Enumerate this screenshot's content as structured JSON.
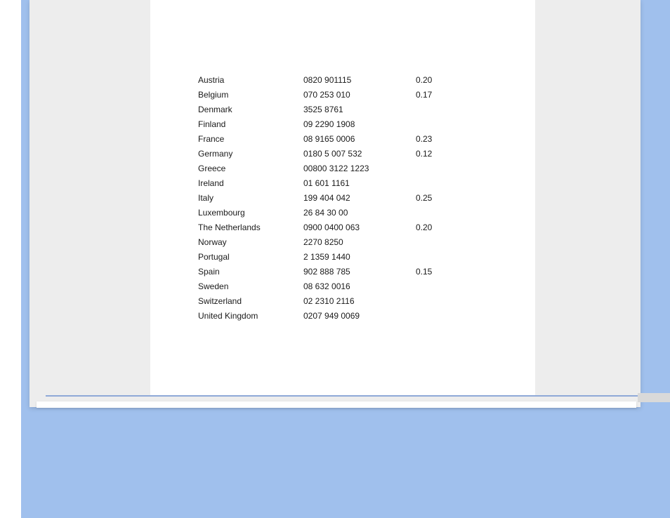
{
  "table": {
    "rows": [
      {
        "country": "Austria",
        "phone": "0820 901115",
        "rate": "0.20"
      },
      {
        "country": "Belgium",
        "phone": "070 253 010",
        "rate": "0.17"
      },
      {
        "country": "Denmark",
        "phone": "3525 8761",
        "rate": ""
      },
      {
        "country": "Finland",
        "phone": "09 2290 1908",
        "rate": ""
      },
      {
        "country": "France",
        "phone": "08 9165 0006",
        "rate": "0.23"
      },
      {
        "country": "Germany",
        "phone": "0180 5 007 532",
        "rate": "0.12"
      },
      {
        "country": "Greece",
        "phone": "00800 3122 1223",
        "rate": ""
      },
      {
        "country": "Ireland",
        "phone": "01 601 1161",
        "rate": ""
      },
      {
        "country": "Italy",
        "phone": "199 404 042",
        "rate": "0.25"
      },
      {
        "country": "Luxembourg",
        "phone": "26 84 30 00",
        "rate": ""
      },
      {
        "country": "The Netherlands",
        "phone": "0900 0400 063",
        "rate": "0.20"
      },
      {
        "country": "Norway",
        "phone": "2270 8250",
        "rate": ""
      },
      {
        "country": "Portugal",
        "phone": "2 1359 1440",
        "rate": ""
      },
      {
        "country": "Spain",
        "phone": "902 888 785",
        "rate": "0.15"
      },
      {
        "country": "Sweden",
        "phone": "08 632 0016",
        "rate": ""
      },
      {
        "country": "Switzerland",
        "phone": "02 2310 2116",
        "rate": ""
      },
      {
        "country": "United Kingdom",
        "phone": "0207 949 0069",
        "rate": ""
      }
    ]
  }
}
